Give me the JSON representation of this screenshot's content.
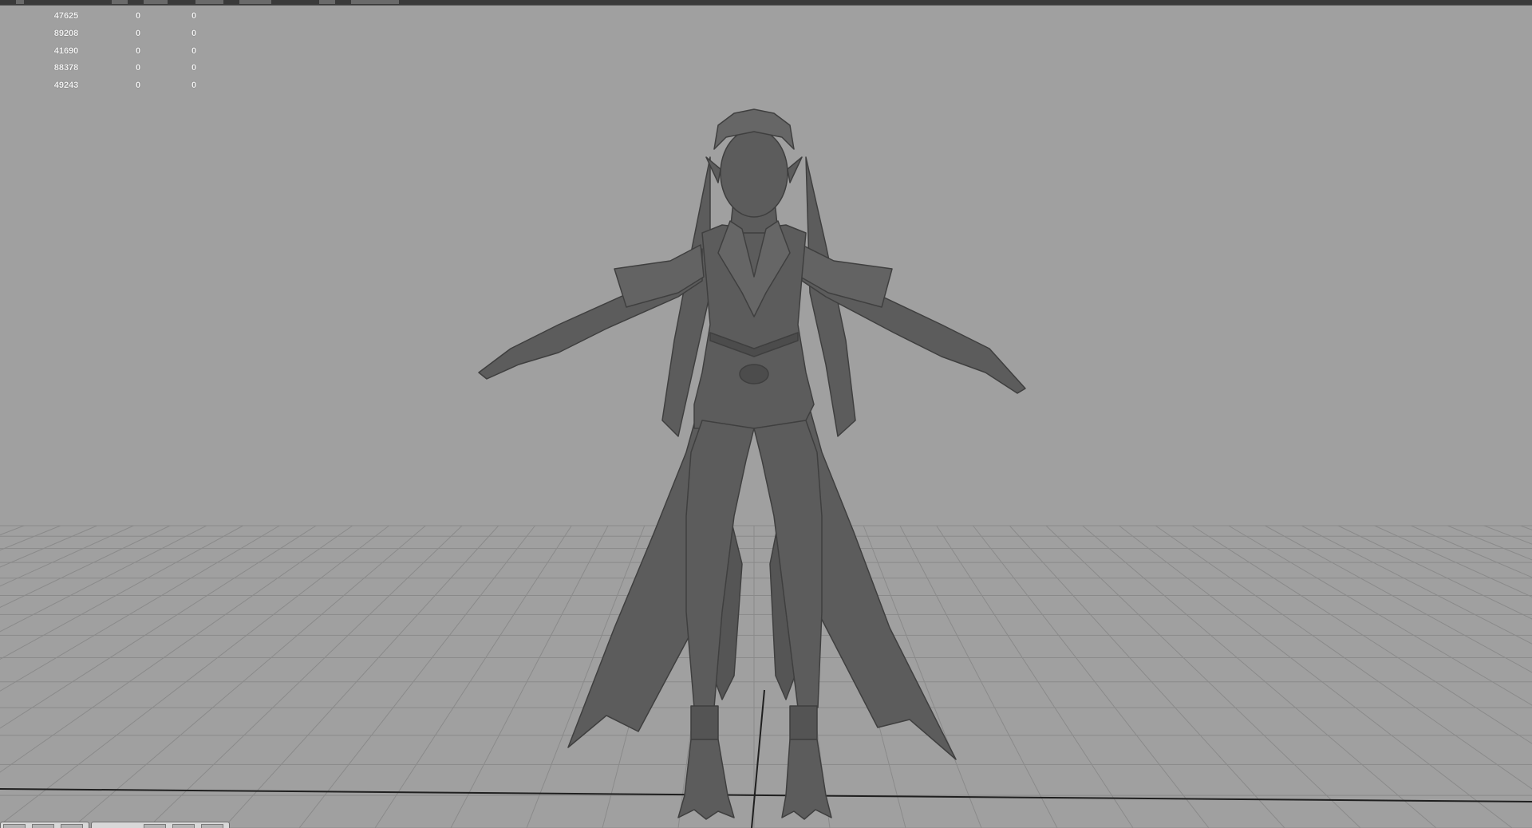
{
  "viewport": {
    "hud_rows": [
      [
        "47625",
        "0",
        "0"
      ],
      [
        "89208",
        "0",
        "0"
      ],
      [
        "41690",
        "0",
        "0"
      ],
      [
        "88378",
        "0",
        "0"
      ],
      [
        "49243",
        "0",
        "0"
      ]
    ],
    "background_color": "#a0a0a0",
    "grid_color": "#8a8a8a",
    "model_color": "#5c5c5c",
    "hud_text_color": "#f2f2f2"
  },
  "icons": {
    "toolbar": "toolbar-icons",
    "shelf": "shelf-buttons"
  }
}
